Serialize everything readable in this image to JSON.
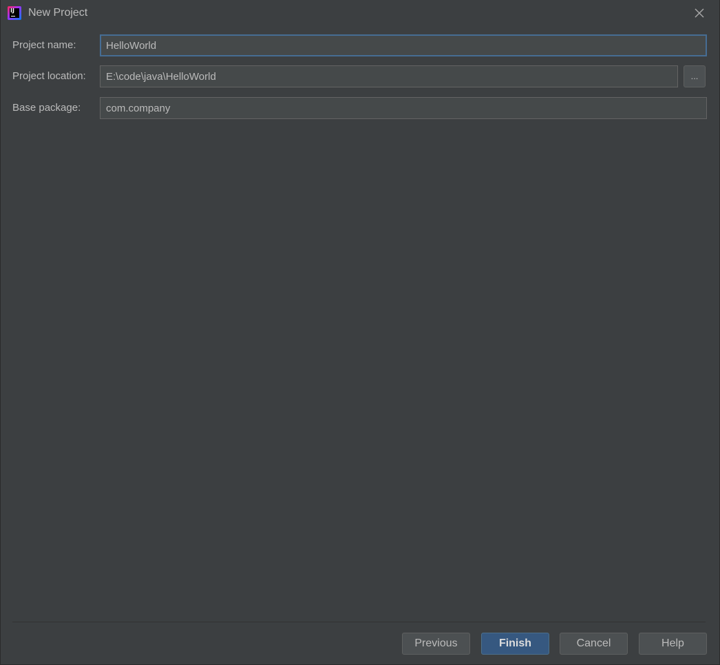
{
  "window": {
    "title": "New Project",
    "app_icon": "intellij-idea-icon",
    "close_icon": "close-icon"
  },
  "form": {
    "project_name": {
      "label": "Project name:",
      "value": "HelloWorld"
    },
    "project_location": {
      "label": "Project location:",
      "value": "E:\\code\\java\\HelloWorld",
      "browse_label": "..."
    },
    "base_package": {
      "label": "Base package:",
      "value": "com.company"
    }
  },
  "footer": {
    "previous_label": "Previous",
    "finish_label": "Finish",
    "cancel_label": "Cancel",
    "help_label": "Help"
  },
  "colors": {
    "background": "#3c3f41",
    "field_background": "#45494a",
    "focus_border": "#466d94",
    "default_button": "#365880",
    "text": "#bbbbbb"
  }
}
